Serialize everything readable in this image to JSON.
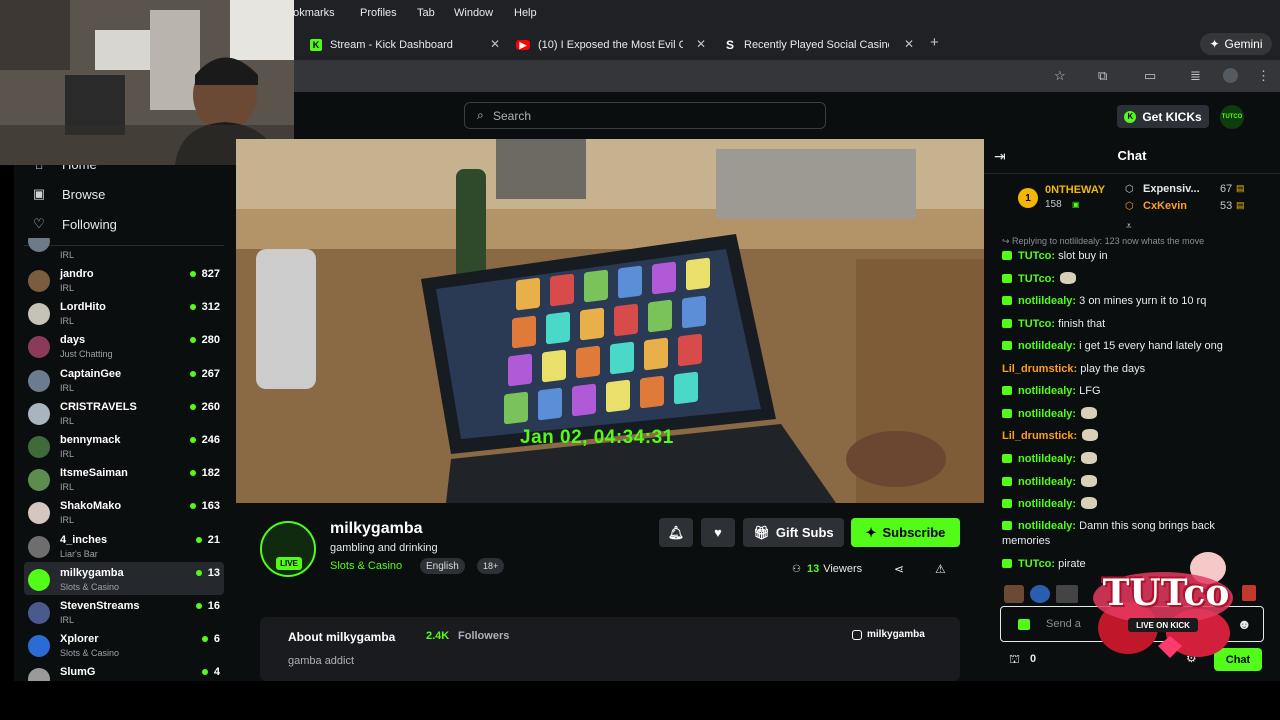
{
  "menubar": {
    "items": [
      "ookmarks",
      "Profiles",
      "Tab",
      "Window",
      "Help"
    ]
  },
  "tabs": [
    {
      "label": "Stream - Kick Dashboard",
      "icon": "kick-icon"
    },
    {
      "label": "(10) I Exposed the Most Evil C",
      "icon": "youtube-icon"
    },
    {
      "label": "Recently Played Social Casinc",
      "icon": "stake-icon"
    }
  ],
  "gemini_label": "Gemini",
  "header": {
    "search_placeholder": "Search",
    "get_kicks": "Get KICKs",
    "avatar_text": "TUTCO"
  },
  "sidebar": {
    "nav": [
      {
        "label": "Home",
        "icon": "home-icon"
      },
      {
        "label": "Browse",
        "icon": "browse-icon"
      },
      {
        "label": "Following",
        "icon": "heart-icon"
      }
    ],
    "first_category": "IRL",
    "channels": [
      {
        "name": "jandro",
        "category": "IRL",
        "viewers": "827",
        "color": "#7a5c3e"
      },
      {
        "name": "LordHito",
        "category": "IRL",
        "viewers": "312",
        "color": "#c7c2b8"
      },
      {
        "name": "days",
        "category": "Just Chatting",
        "viewers": "280",
        "color": "#8b3a5a"
      },
      {
        "name": "CaptainGee",
        "category": "IRL",
        "viewers": "267",
        "color": "#6a7d8f"
      },
      {
        "name": "CRISTRAVELS",
        "category": "IRL",
        "viewers": "260",
        "color": "#a8b4c0"
      },
      {
        "name": "bennymack",
        "category": "IRL",
        "viewers": "246",
        "color": "#3f6b3a"
      },
      {
        "name": "ItsmeSaiman",
        "category": "IRL",
        "viewers": "182",
        "color": "#5c8d4e"
      },
      {
        "name": "ShakoMako",
        "category": "IRL",
        "viewers": "163",
        "color": "#d6c6c0"
      },
      {
        "name": "4_inches",
        "category": "Liar's Bar",
        "viewers": "21",
        "color": "#6e6e6e"
      },
      {
        "name": "milkygamba",
        "category": "Slots & Casino",
        "viewers": "13",
        "color": "#53fc18",
        "active": true
      },
      {
        "name": "StevenStreams",
        "category": "IRL",
        "viewers": "16",
        "color": "#4a5a8c"
      },
      {
        "name": "Xplorer",
        "category": "Slots & Casino",
        "viewers": "6",
        "color": "#2b6cd4"
      },
      {
        "name": "SlumG",
        "category": "",
        "viewers": "4",
        "color": "#9a9a9a"
      }
    ]
  },
  "video": {
    "timestamp": "Jan 02, 04:34:31"
  },
  "stream": {
    "live_badge": "LIVE",
    "channel": "milkygamba",
    "title": "gambling and drinking",
    "category": "Slots & Casino",
    "tags": [
      "English",
      "18+"
    ],
    "gift_subs": "Gift Subs",
    "subscribe": "Subscribe",
    "viewers_count": "13",
    "viewers_label": "Viewers"
  },
  "about": {
    "title": "About milkygamba",
    "followers_count": "2.4K",
    "followers_label": "Followers",
    "bio": "gamba addict",
    "instagram": "milkygamba"
  },
  "chat": {
    "title": "Chat",
    "leaderboard": {
      "top": {
        "rank": "1",
        "name": "0NTHEWAY",
        "points": "158"
      },
      "others": [
        {
          "name": "Expensiv...",
          "points": "67"
        },
        {
          "name": "CxKevin",
          "points": "53"
        }
      ]
    },
    "reply_note": "Replying to notlildealy: 123 now whats the move",
    "messages": [
      {
        "user": "TUTco",
        "text": "slot buy in",
        "badge": true,
        "color": "green"
      },
      {
        "user": "TUTco",
        "text": "",
        "badge": true,
        "color": "green",
        "emote": true
      },
      {
        "user": "notlildealy",
        "text": "3 on mines yurn it to 10 rq",
        "badge": true,
        "color": "green"
      },
      {
        "user": "TUTco",
        "text": "finish that",
        "badge": true,
        "color": "green"
      },
      {
        "user": "notlildealy",
        "text": "i get 15 every hand lately ong",
        "badge": true,
        "color": "green"
      },
      {
        "user": "Lil_drumstick",
        "text": "play the days",
        "badge": false,
        "color": "orange"
      },
      {
        "user": "notlildealy",
        "text": "LFG",
        "badge": true,
        "color": "green"
      },
      {
        "user": "notlildealy",
        "text": "",
        "badge": true,
        "color": "green",
        "emote": true
      },
      {
        "user": "Lil_drumstick",
        "text": "",
        "badge": false,
        "color": "orange",
        "emote": true
      },
      {
        "user": "notlildealy",
        "text": "",
        "badge": true,
        "color": "green",
        "emote": true
      },
      {
        "user": "notlildealy",
        "text": "",
        "badge": true,
        "color": "green",
        "emote": true
      },
      {
        "user": "notlildealy",
        "text": "",
        "badge": true,
        "color": "green",
        "emote": true
      },
      {
        "user": "notlildealy",
        "text": "Damn this song brings back memories",
        "badge": true,
        "color": "green"
      },
      {
        "user": "TUTco",
        "text": "pirate",
        "badge": true,
        "color": "green"
      }
    ],
    "input_placeholder": "Send a",
    "points": "0",
    "send_button": "Chat"
  },
  "overlay": {
    "logo_text": "TUTco",
    "logo_sub": "LIVE ON KICK"
  },
  "colors": {
    "accent": "#53fc18",
    "bg": "#0b0e0f",
    "panel": "#191b1f"
  }
}
